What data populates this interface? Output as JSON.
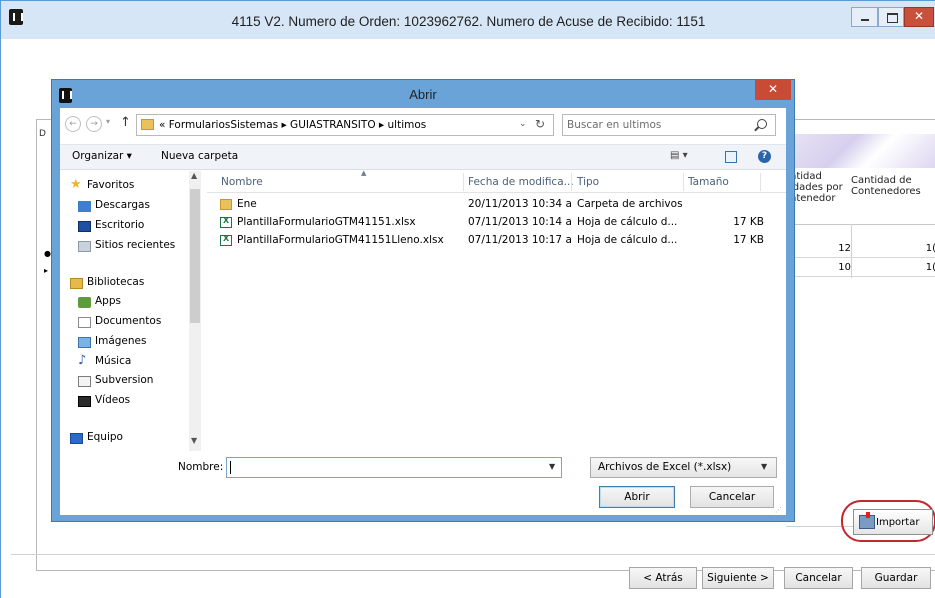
{
  "main_window": {
    "title": "4115 V2. Numero de Orden: 1023962762. Numero de Acuse de Recibido: 1151",
    "close_glyph": "✕",
    "background_grid": {
      "col1_header": "ntidad idades por ntenedor",
      "col2_header": "Cantidad de Contenedores",
      "rows": [
        {
          "v1": "12",
          "v2": "1("
        },
        {
          "v1": "10",
          "v2": "1("
        }
      ]
    },
    "import_button": "Importar",
    "buttons": {
      "back": "< Atrás",
      "next": "Siguiente >",
      "cancel": "Cancelar",
      "save": "Guardar"
    }
  },
  "dialog": {
    "title": "Abrir",
    "close_glyph": "✕",
    "address": {
      "path": "« FormulariosSistemas ▸ GUIASTRANSITO ▸ ultimos",
      "dropdown_glyph": "⌄",
      "refresh_glyph": "↻"
    },
    "search": {
      "placeholder": "Buscar en ultimos"
    },
    "toolbar": {
      "organize": "Organizar ▾",
      "new_folder": "Nueva carpeta",
      "view": "▤ ▾",
      "help": "?"
    },
    "nav_pane": {
      "favorites": "Favoritos",
      "downloads": "Descargas",
      "desktop": "Escritorio",
      "recent": "Sitios recientes",
      "libraries": "Bibliotecas",
      "apps": "Apps",
      "documents": "Documentos",
      "images": "Imágenes",
      "music": "Música",
      "subversion": "Subversion",
      "videos": "Vídeos",
      "computer": "Equipo"
    },
    "columns": {
      "name": "Nombre",
      "date": "Fecha de modifica...",
      "type": "Tipo",
      "size": "Tamaño"
    },
    "files": [
      {
        "name": "Ene",
        "date": "20/11/2013 10:34 a...",
        "type": "Carpeta de archivos",
        "size": "",
        "kind": "folder"
      },
      {
        "name": "PlantillaFormularioGTM41151.xlsx",
        "date": "07/11/2013 10:14 a...",
        "type": "Hoja de cálculo d...",
        "size": "17 KB",
        "kind": "xlsx"
      },
      {
        "name": "PlantillaFormularioGTM41151Lleno.xlsx",
        "date": "07/11/2013 10:17 a...",
        "type": "Hoja de cálculo d...",
        "size": "17 KB",
        "kind": "xlsx"
      }
    ],
    "filename_label": "Nombre:",
    "filename_value": "",
    "filter": "Archivos de Excel (*.xlsx)",
    "open_button": "Abrir",
    "cancel_button": "Cancelar"
  }
}
